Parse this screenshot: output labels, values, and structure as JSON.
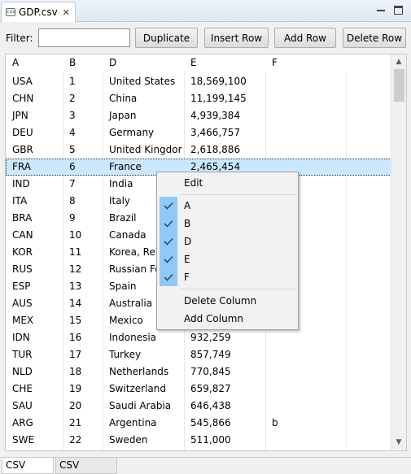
{
  "tab": {
    "title": "GDP.csv",
    "icon": "csv-file-icon"
  },
  "toolbar": {
    "filter_label": "Filter:",
    "filter_value": "",
    "duplicate_label": "Duplicate",
    "insert_row_label": "Insert Row",
    "add_row_label": "Add Row",
    "delete_row_label": "Delete Row"
  },
  "table": {
    "headers": [
      "A",
      "B",
      "D",
      "E",
      "F"
    ],
    "selected_row": 5,
    "rows": [
      [
        "USA",
        "1",
        "United States",
        "18,569,100",
        ""
      ],
      [
        "CHN",
        "2",
        "China",
        "11,199,145",
        ""
      ],
      [
        "JPN",
        "3",
        "Japan",
        "4,939,384",
        ""
      ],
      [
        "DEU",
        "4",
        "Germany",
        "3,466,757",
        ""
      ],
      [
        "GBR",
        "5",
        "United Kingdor",
        "2,618,886",
        ""
      ],
      [
        "FRA",
        "6",
        "France",
        "2,465,454",
        ""
      ],
      [
        "IND",
        "7",
        "India",
        "",
        ""
      ],
      [
        "ITA",
        "8",
        "Italy",
        "",
        ""
      ],
      [
        "BRA",
        "9",
        "Brazil",
        "",
        ""
      ],
      [
        "CAN",
        "10",
        "Canada",
        "",
        ""
      ],
      [
        "KOR",
        "11",
        "Korea, Rep",
        "",
        ""
      ],
      [
        "RUS",
        "12",
        "Russian Fe",
        "",
        ""
      ],
      [
        "ESP",
        "13",
        "Spain",
        "",
        ""
      ],
      [
        "AUS",
        "14",
        "Australia",
        "",
        ""
      ],
      [
        "MEX",
        "15",
        "Mexico",
        "",
        ""
      ],
      [
        "IDN",
        "16",
        "Indonesia",
        "932,259",
        ""
      ],
      [
        "TUR",
        "17",
        "Turkey",
        "857,749",
        ""
      ],
      [
        "NLD",
        "18",
        "Netherlands",
        "770,845",
        ""
      ],
      [
        "CHE",
        "19",
        "Switzerland",
        "659,827",
        ""
      ],
      [
        "SAU",
        "20",
        "Saudi Arabia",
        "646,438",
        ""
      ],
      [
        "ARG",
        "21",
        "Argentina",
        "545,866",
        "b"
      ],
      [
        "SWE",
        "22",
        "Sweden",
        "511,000",
        ""
      ]
    ]
  },
  "context_menu": {
    "edit_label": "Edit",
    "column_toggles": [
      {
        "label": "A",
        "checked": true
      },
      {
        "label": "B",
        "checked": true
      },
      {
        "label": "D",
        "checked": true
      },
      {
        "label": "E",
        "checked": true
      },
      {
        "label": "F",
        "checked": true
      }
    ],
    "delete_column_label": "Delete Column",
    "add_column_label": "Add Column"
  },
  "bottom_tabs": {
    "table_label": "CSV Table",
    "source_label": "CSV Source"
  },
  "colors": {
    "selection": "#cce8ff",
    "check_highlight": "#90c8f6"
  }
}
